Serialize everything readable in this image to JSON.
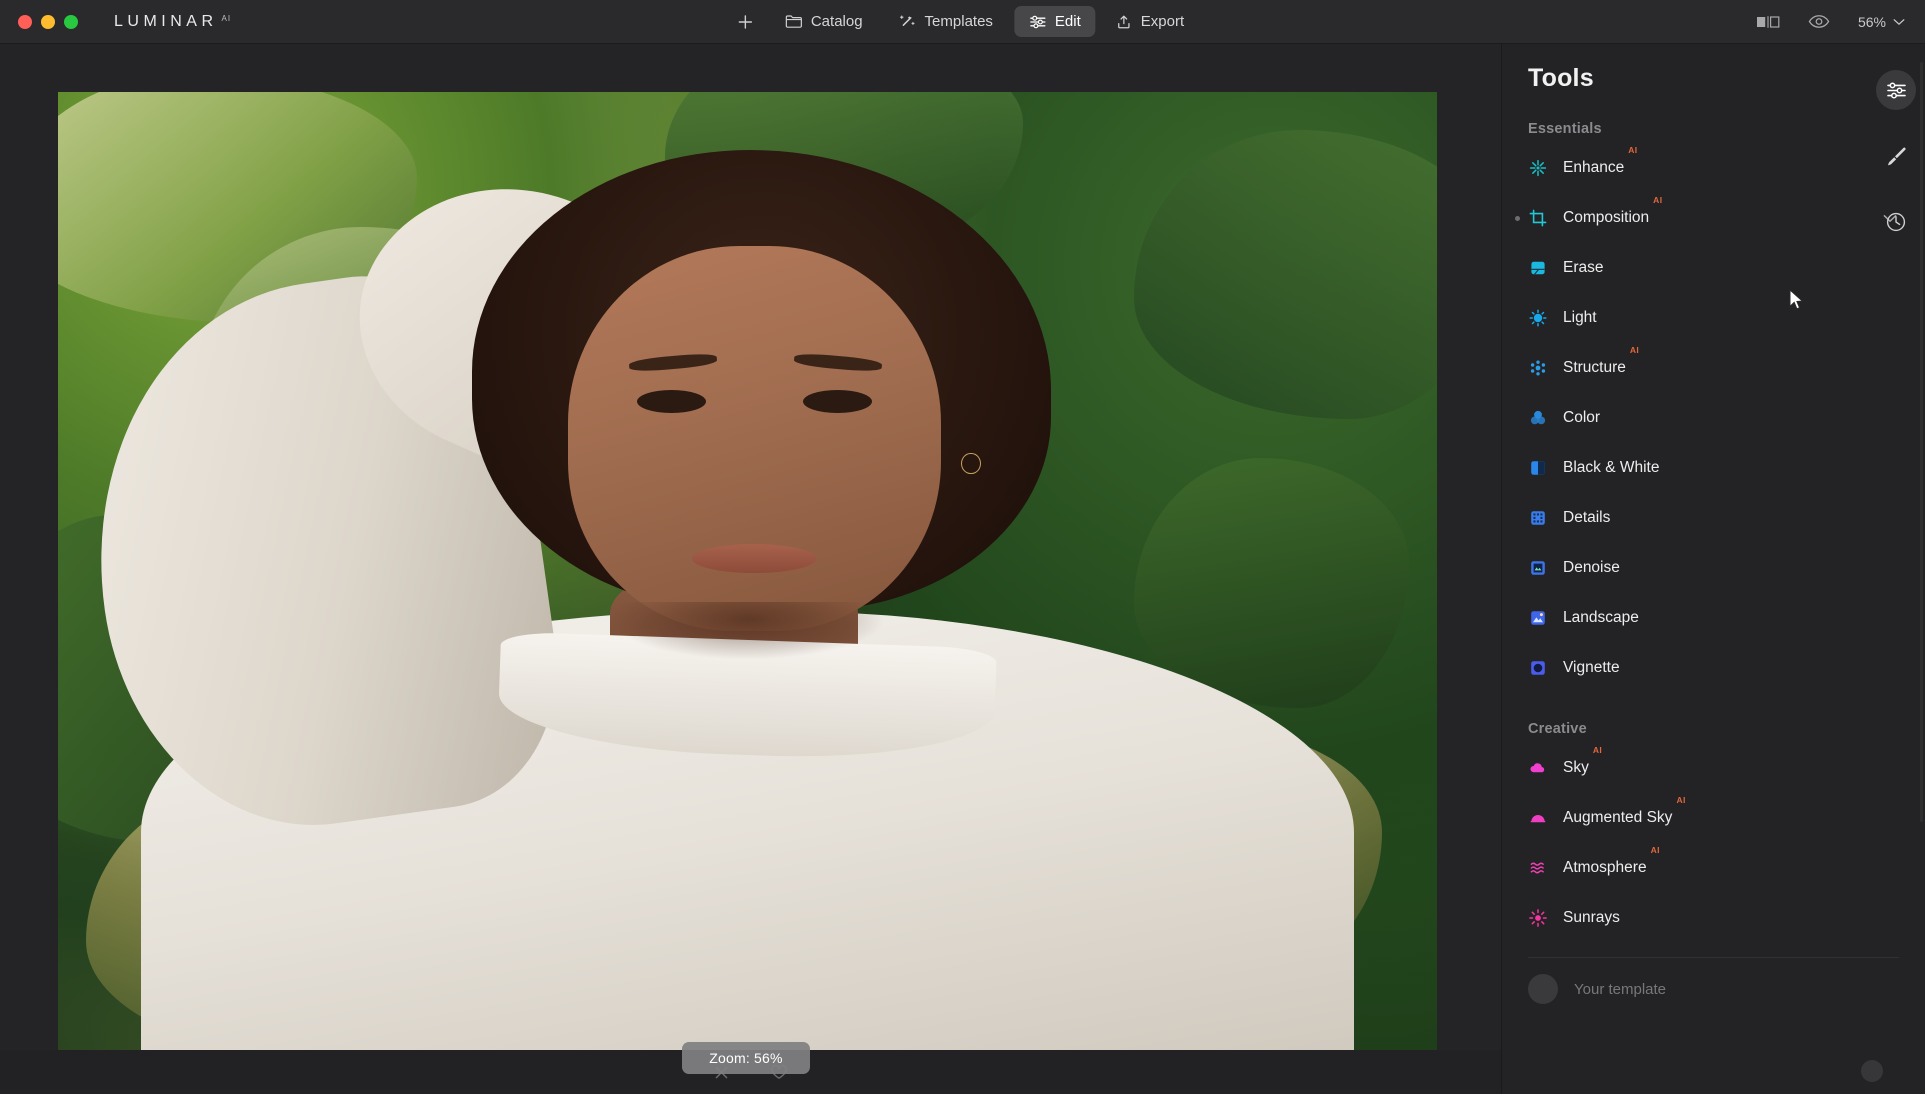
{
  "window": {
    "brand_name": "LUMINAR",
    "brand_suffix": "AI",
    "traffic_lights": [
      "close",
      "minimize",
      "maximize"
    ]
  },
  "topbar": {
    "add_label": "+",
    "nav": [
      {
        "id": "catalog",
        "label": "Catalog",
        "icon": "folder-icon",
        "active": false
      },
      {
        "id": "templates",
        "label": "Templates",
        "icon": "wand-icon",
        "active": false
      },
      {
        "id": "edit",
        "label": "Edit",
        "icon": "sliders-icon",
        "active": true
      },
      {
        "id": "export",
        "label": "Export",
        "icon": "upload-icon",
        "active": false
      }
    ],
    "compare_icon": "before-after-icon",
    "preview_icon": "eye-icon",
    "zoom_value": "56%",
    "zoom_chevron": "chevron-down-icon"
  },
  "canvas": {
    "zoom_toast": "Zoom: 56%",
    "bottom_actions": [
      {
        "id": "reject",
        "icon": "close-icon"
      },
      {
        "id": "favorite",
        "icon": "heart-icon"
      }
    ]
  },
  "tools": {
    "title": "Tools",
    "settings_icon": "sliders-icon",
    "sections": [
      {
        "label": "Essentials",
        "items": [
          {
            "label": "Enhance",
            "icon": "sparkle-icon",
            "ai": "AI",
            "color": "#17c0c7",
            "selected": false,
            "expandable": false
          },
          {
            "label": "Composition",
            "icon": "crop-icon",
            "ai": "AI",
            "color": "#20c9d6",
            "selected": true,
            "expandable": true
          },
          {
            "label": "Erase",
            "icon": "eraser-icon",
            "ai": "",
            "color": "#1bb9e0",
            "selected": false,
            "expandable": false
          },
          {
            "label": "Light",
            "icon": "sun-icon",
            "ai": "",
            "color": "#1aa8e8",
            "selected": false,
            "expandable": false
          },
          {
            "label": "Structure",
            "icon": "structure-icon",
            "ai": "AI",
            "color": "#2a9ce8",
            "selected": false,
            "expandable": false
          },
          {
            "label": "Color",
            "icon": "color-icon",
            "ai": "",
            "color": "#2b8fe6",
            "selected": false,
            "expandable": false
          },
          {
            "label": "Black & White",
            "icon": "halfmoon-icon",
            "ai": "",
            "color": "#2a86e8",
            "selected": false,
            "expandable": false
          },
          {
            "label": "Details",
            "icon": "grid-icon",
            "ai": "",
            "color": "#3a7ce8",
            "selected": false,
            "expandable": false
          },
          {
            "label": "Denoise",
            "icon": "noise-icon",
            "ai": "",
            "color": "#3f74e8",
            "selected": false,
            "expandable": false
          },
          {
            "label": "Landscape",
            "icon": "mountain-icon",
            "ai": "",
            "color": "#3f66ea",
            "selected": false,
            "expandable": false
          },
          {
            "label": "Vignette",
            "icon": "vignette-icon",
            "ai": "",
            "color": "#4a5cec",
            "selected": false,
            "expandable": false
          }
        ]
      },
      {
        "label": "Creative",
        "items": [
          {
            "label": "Sky",
            "icon": "cloud-icon",
            "ai": "AI",
            "color": "#f13fd0",
            "selected": false,
            "expandable": false
          },
          {
            "label": "Augmented Sky",
            "icon": "dome-icon",
            "ai": "AI",
            "color": "#ef3fc2",
            "selected": false,
            "expandable": false
          },
          {
            "label": "Atmosphere",
            "icon": "waves-icon",
            "ai": "AI",
            "color": "#f23fb4",
            "selected": false,
            "expandable": false
          },
          {
            "label": "Sunrays",
            "icon": "sunburst-icon",
            "ai": "",
            "color": "#f4369e",
            "selected": false,
            "expandable": false
          }
        ]
      }
    ],
    "footer": {
      "template_label": "Your template",
      "thumb": "template-thumbnail"
    }
  },
  "rail": {
    "buttons": [
      {
        "id": "adjust",
        "icon": "sliders-icon",
        "active": true
      },
      {
        "id": "brush",
        "icon": "brush-icon",
        "active": false
      },
      {
        "id": "history",
        "icon": "clock-icon",
        "active": false
      }
    ]
  },
  "colors": {
    "accent_ai": "#e2673c",
    "panel_bg": "#232325",
    "canvas_bg": "#242426",
    "topbar_bg": "#2a2a2c"
  }
}
